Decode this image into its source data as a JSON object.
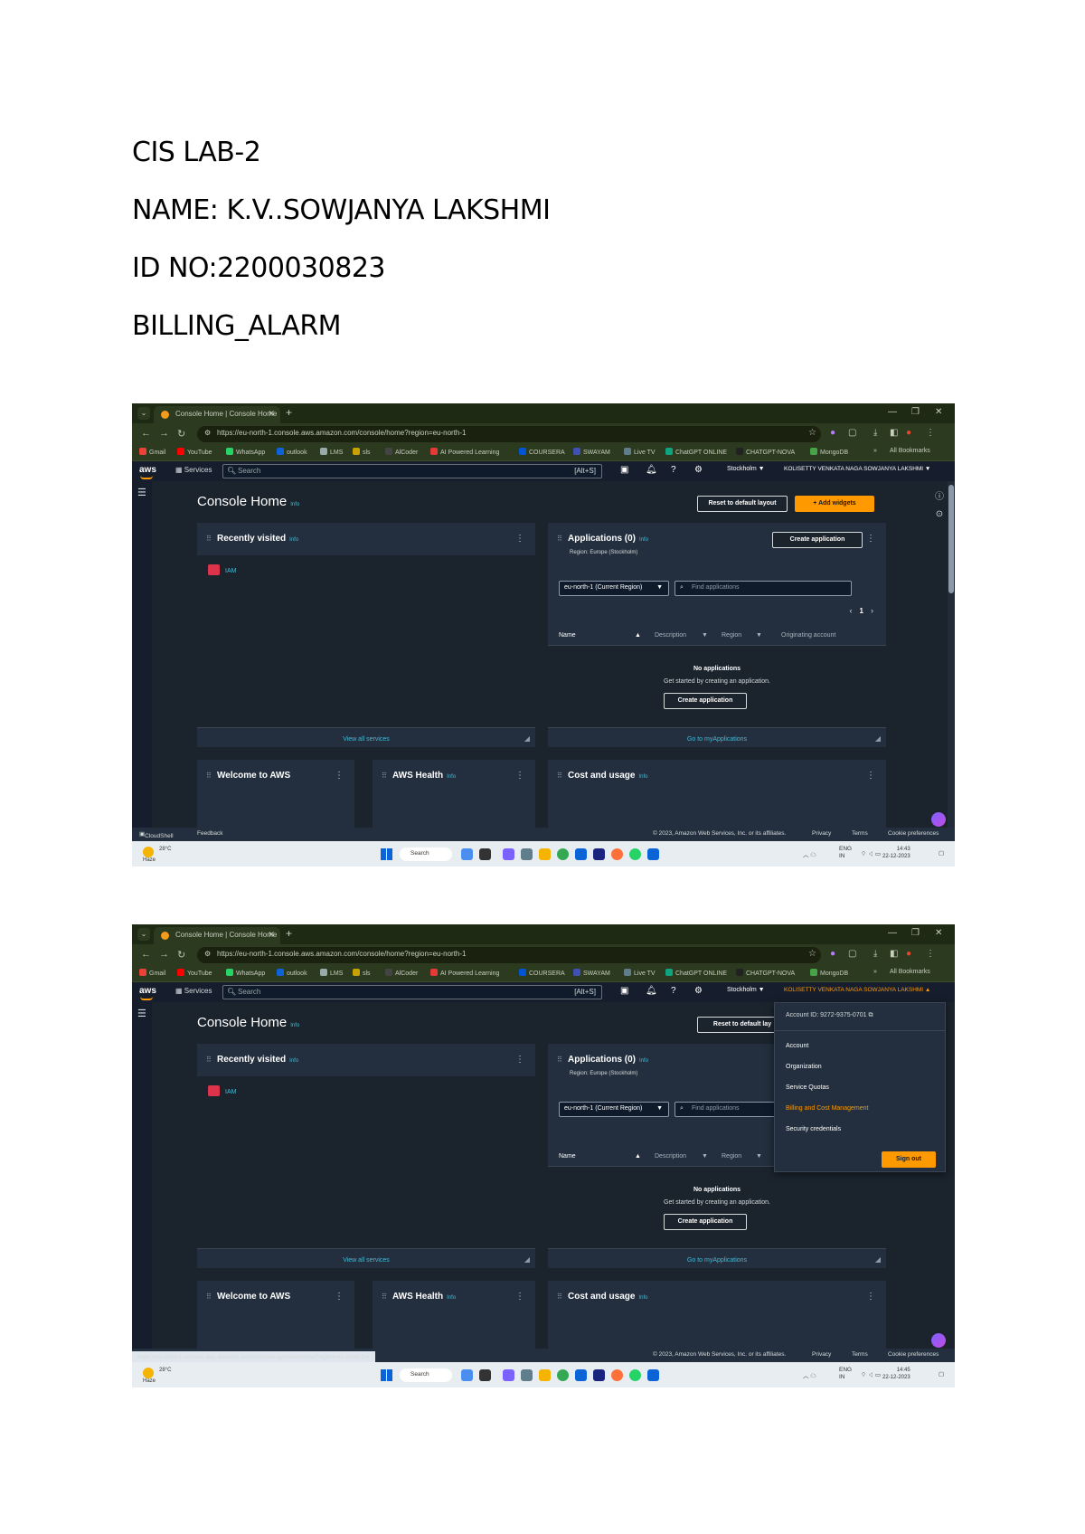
{
  "document": {
    "headings": [
      "CIS LAB-2",
      "NAME: K.V..SOWJANYA LAKSHMI",
      "ID NO:2200030823",
      "BILLING_ALARM"
    ]
  },
  "browser": {
    "tab_title": "Console Home | Console Home",
    "url_1": "https://eu-north-1.console.aws.amazon.com/console/home?region=eu-north-1",
    "url_2": "https://eu-north-1.console.aws.amazon.com/console/home?region=eu-north-1",
    "bookmarks": [
      "Gmail",
      "YouTube",
      "WhatsApp",
      "outlook",
      "LMS",
      "sls",
      "AlCoder",
      "AI Powered Learning",
      "COURSERA",
      "SWAYAM",
      "Live TV",
      "ChatGPT ONLINE",
      "CHATGPT-NOVA",
      "MongoDB"
    ],
    "all_bookmarks": "All Bookmarks"
  },
  "aws": {
    "services_label": "Services",
    "search_placeholder": "Search",
    "search_shortcut": "[Alt+S]",
    "region": "Stockholm ▼",
    "account_name": "KOLISETTY VENKATA NAGA SOWJANYA LAKSHMI ▼",
    "account_name_open": "KOLISETTY VENKATA NAGA SOWJANYA LAKSHMI ▲",
    "console_home": "Console Home",
    "info": "Info",
    "reset_layout": "Reset to default layout",
    "reset_layout_clipped": "Reset to default lay",
    "add_widgets": "+ Add widgets",
    "recently_visited": "Recently visited",
    "iam": "IAM",
    "view_all_services": "View all services",
    "applications": "Applications (0)",
    "region_sub": "Region: Europe (Stockholm)",
    "create_application": "Create application",
    "region_select": "eu-north-1 (Current Region)",
    "find_placeholder": "Find applications",
    "page_number": "1",
    "col_name": "Name",
    "col_description": "Description",
    "col_region": "Region",
    "col_origin": "Originating account",
    "no_apps": "No applications",
    "no_apps_sub": "Get started by creating an application.",
    "go_myapps": "Go to myApplications",
    "welcome": "Welcome to AWS",
    "health": "AWS Health",
    "cost": "Cost and usage",
    "cloudshell": "CloudShell",
    "feedback": "Feedback",
    "copyright": "© 2023, Amazon Web Services, Inc. or its affiliates.",
    "privacy": "Privacy",
    "terms": "Terms",
    "cookies": "Cookie preferences",
    "status_url": "https://eu-north-1.console.aws.amazon.com/costmanagement/home?region=eu-north-1#/"
  },
  "account_menu": {
    "account_id": "Account ID: 9272-9375-0701",
    "items": [
      "Account",
      "Organization",
      "Service Quotas",
      "Billing and Cost Management",
      "Security credentials"
    ],
    "sign_out": "Sign out"
  },
  "taskbar": {
    "temp": "28°C",
    "weather": "Haze",
    "search": "Search",
    "lang": "ENG",
    "lang2": "IN",
    "time_1": "14:43",
    "time_2": "14:45",
    "date": "22-12-2023"
  }
}
